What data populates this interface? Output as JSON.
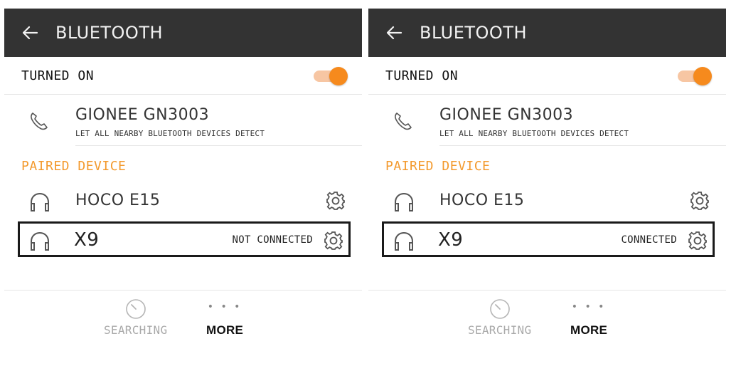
{
  "colors": {
    "header_bg": "#333333",
    "accent": "#f68a1d",
    "section_label": "#f39a2e",
    "disabled_text": "#a9a9a9"
  },
  "screens": [
    {
      "header": {
        "title": "BLUETOOTH",
        "back_icon": "arrow-left-icon"
      },
      "toggle": {
        "label": "TURNED ON",
        "state": "on"
      },
      "device": {
        "icon": "phone-icon",
        "name": "GIONEE GN3003",
        "subtitle": "LET ALL NEARBY BLUETOOTH DEVICES DETECT"
      },
      "paired_label": "PAIRED DEVICE",
      "paired": [
        {
          "icon": "headphones-icon",
          "name": "HOCO E15",
          "status": "",
          "settings_icon": "gear-icon",
          "highlighted": false
        },
        {
          "icon": "headphones-icon",
          "name": "X9",
          "status": "NOT CONNECTED",
          "settings_icon": "gear-icon",
          "highlighted": true
        }
      ],
      "bottom": {
        "search": {
          "label": "SEARCHING",
          "icon": "search-progress-icon"
        },
        "more": {
          "label": "MORE",
          "icon": "more-dots-icon"
        }
      }
    },
    {
      "header": {
        "title": "BLUETOOTH",
        "back_icon": "arrow-left-icon"
      },
      "toggle": {
        "label": "TURNED ON",
        "state": "on"
      },
      "device": {
        "icon": "phone-icon",
        "name": "GIONEE GN3003",
        "subtitle": "LET ALL NEARBY BLUETOOTH DEVICES DETECT"
      },
      "paired_label": "PAIRED DEVICE",
      "paired": [
        {
          "icon": "headphones-icon",
          "name": "HOCO E15",
          "status": "",
          "settings_icon": "gear-icon",
          "highlighted": false
        },
        {
          "icon": "headphones-icon",
          "name": "X9",
          "status": "CONNECTED",
          "settings_icon": "gear-icon",
          "highlighted": true
        }
      ],
      "bottom": {
        "search": {
          "label": "SEARCHING",
          "icon": "search-progress-icon"
        },
        "more": {
          "label": "MORE",
          "icon": "more-dots-icon"
        }
      }
    }
  ]
}
